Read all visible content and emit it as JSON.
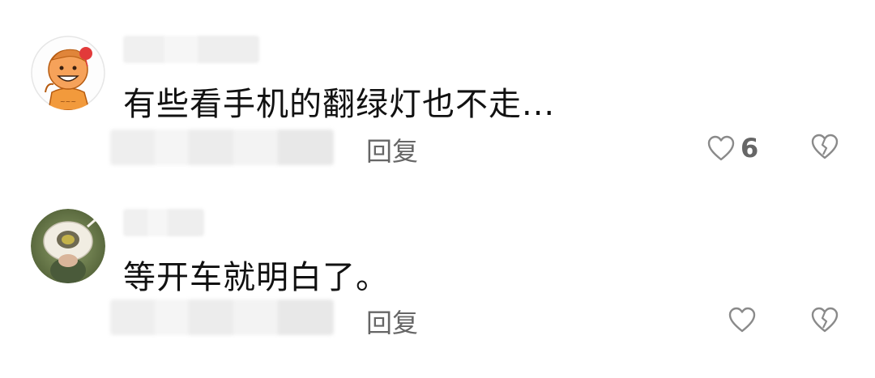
{
  "comments": [
    {
      "text": "有些看手机的翻绿灯也不走...",
      "reply_label": "回复",
      "like_count": "6",
      "like_icon": "heart-outline-icon",
      "dislike_icon": "broken-heart-icon"
    },
    {
      "text": "等开车就明白了。",
      "reply_label": "回复",
      "like_count": "",
      "like_icon": "heart-outline-icon",
      "dislike_icon": "broken-heart-icon"
    }
  ]
}
